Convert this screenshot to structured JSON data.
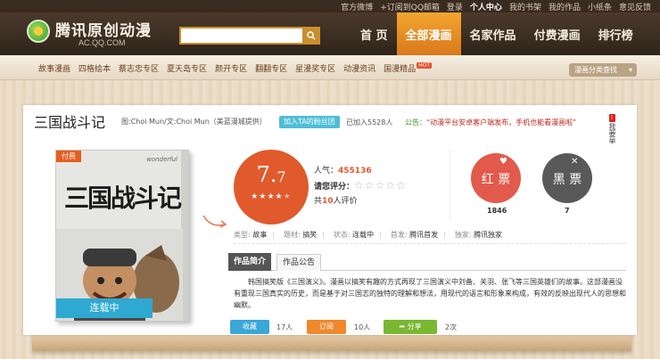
{
  "topbar": {
    "links": [
      "官方微博",
      "+订阅到QQ邮箱",
      "登录",
      "个人中心",
      "我的书架",
      "我的作品",
      "小纸条",
      "意见反馈"
    ]
  },
  "header": {
    "logo_name": "腾讯原创动漫",
    "logo_domain": "AC.QQ.COM",
    "search_placeholder": "",
    "nav": [
      {
        "label": "首 页",
        "active": false
      },
      {
        "label": "全部漫画",
        "active": true
      },
      {
        "label": "名家作品",
        "active": false
      },
      {
        "label": "付费漫画",
        "active": false
      },
      {
        "label": "排行榜",
        "active": false
      }
    ]
  },
  "subnav": {
    "items": [
      "故事漫画",
      "四格绘本",
      "蔡志忠专区",
      "夏天岛专区",
      "颜开专区",
      "翻翻专区",
      "星漫奖专区",
      "动漫资讯",
      "国漫精品"
    ],
    "hot_badge": "HOT",
    "finder_label": "漫画分类查找"
  },
  "comic": {
    "title": "三国战斗记",
    "authors": "图:Choi Mun/文:Choi Mun（美蓝漫城提供）",
    "fan_button": "加入TA的粉丝团",
    "fan_count": "已加入5528人",
    "notice_label": "公告：",
    "notice_text": "“动漫平台安卓客户端发布，手机也能看漫画啦”",
    "report_label": "我要举",
    "cover": {
      "paid_tag": "付费",
      "publisher_mark": "wonderful",
      "cover_title": "三国战斗记",
      "status": "连载中"
    },
    "rating": {
      "score_main": "7.",
      "score_dec": "7",
      "stars_filled": 4,
      "stars_total": 5
    },
    "popularity_label": "人气：",
    "popularity_value": "455136",
    "rate_label": "请您评分：",
    "rater_prefix": "共",
    "rater_count": "10",
    "rater_suffix": "人评价",
    "red_ticket_label": "红 票",
    "red_ticket_count": "1846",
    "black_ticket_label": "黑 票",
    "black_ticket_count": "7",
    "meta": [
      {
        "key": "类型:",
        "value": "故事"
      },
      {
        "key": "题材:",
        "value": "搞笑"
      },
      {
        "key": "状态:",
        "value": "连载中"
      },
      {
        "key": "首发:",
        "value": "腾讯首发"
      },
      {
        "key": "独家:",
        "value": "腾讯独家"
      }
    ],
    "tabs": [
      {
        "label": "作品简介",
        "active": true
      },
      {
        "label": "作品公告",
        "active": false
      }
    ],
    "description": "韩国搞笑版《三国演义》。漫画以搞笑有趣的方式再现了三国演义中刘备、关羽、张飞等三国英雄们的故事。这部漫画没有重现三国真实的历史，而是基于对三国志的独特的理解和想法，用现代的语言和形象来构成，有效的反映出现代人的思想和幽默。",
    "actions": [
      {
        "label": "收藏",
        "count": "17人"
      },
      {
        "label": "订阅",
        "count": "10人"
      },
      {
        "label": "分享",
        "count": "2次"
      }
    ]
  },
  "colors": {
    "accent_orange": "#f2a52e",
    "rating_red": "#e05a2c",
    "status_blue": "#2ea9d2"
  }
}
